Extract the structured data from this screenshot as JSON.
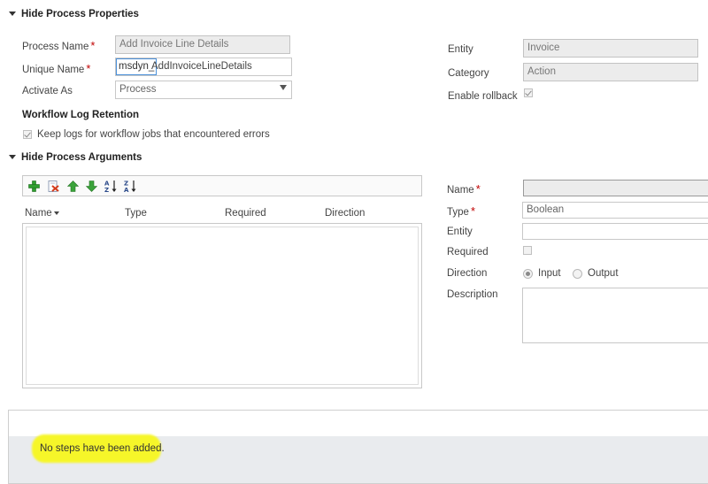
{
  "process_properties": {
    "header": "Hide Process Properties",
    "process_name_label": "Process Name",
    "process_name_value": "Add Invoice Line Details",
    "unique_name_label": "Unique Name",
    "unique_name_prefix": "msdyn_",
    "unique_name_value": "AddInvoiceLineDetails",
    "activate_as_label": "Activate As",
    "activate_as_value": "Process",
    "workflow_log_header": "Workflow Log Retention",
    "keep_logs_label": "Keep logs for workflow jobs that encountered errors",
    "keep_logs_checked": true,
    "entity_label": "Entity",
    "entity_value": "Invoice",
    "category_label": "Category",
    "category_value": "Action",
    "enable_rollback_label": "Enable rollback",
    "enable_rollback_checked": true
  },
  "process_arguments": {
    "header": "Hide Process Arguments",
    "toolbar_icons": [
      "add-icon",
      "delete-icon",
      "move-up-icon",
      "move-down-icon",
      "sort-ascending-icon",
      "sort-descending-icon"
    ],
    "columns": [
      "Name",
      "Type",
      "Required",
      "Direction"
    ],
    "name_label": "Name",
    "name_value": "",
    "type_label": "Type",
    "type_value": "Boolean",
    "entity_label": "Entity",
    "entity_value": "",
    "required_label": "Required",
    "direction_label": "Direction",
    "direction_input": "Input",
    "direction_output": "Output",
    "direction_selected": "Input",
    "description_label": "Description"
  },
  "steps": {
    "message": "No steps have been added.",
    "highlight_color": "#f6f629"
  }
}
